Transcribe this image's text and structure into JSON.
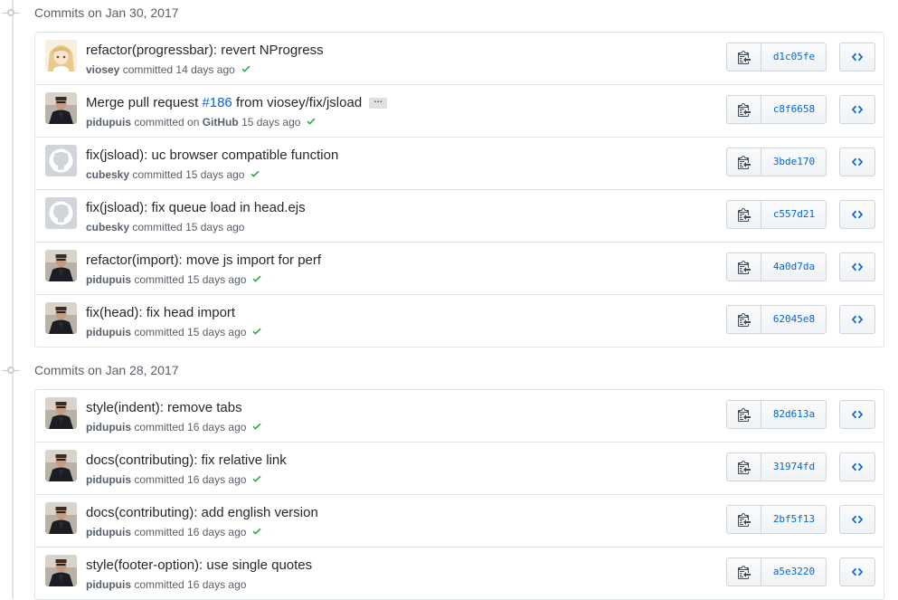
{
  "groups": [
    {
      "title": "Commits on Jan 30, 2017",
      "commits": [
        {
          "message": "refactor(progressbar): revert NProgress",
          "author": "viosey",
          "action": "committed",
          "time": "14 days ago",
          "sha": "d1c05fe",
          "avatar": "anime",
          "verified": true
        },
        {
          "message_pre": "Merge pull request ",
          "issue": "#186",
          "message_post": " from viosey/fix/jsload",
          "ellipsis": "…",
          "author": "pidupuis",
          "action": "committed on",
          "platform": "GitHub",
          "time": "15 days ago",
          "sha": "c8f6658",
          "avatar": "person",
          "verified": true
        },
        {
          "message": "fix(jsload): uc browser compatible function",
          "author": "cubesky",
          "action": "committed",
          "time": "15 days ago",
          "sha": "3bde170",
          "avatar": "github-default",
          "verified": true
        },
        {
          "message": "fix(jsload): fix queue load in head.ejs",
          "author": "cubesky",
          "action": "committed",
          "time": "15 days ago",
          "sha": "c557d21",
          "avatar": "github-default",
          "verified": false
        },
        {
          "message": "refactor(import): move js import for perf",
          "author": "pidupuis",
          "action": "committed",
          "time": "15 days ago",
          "sha": "4a0d7da",
          "avatar": "person",
          "verified": true
        },
        {
          "message": "fix(head): fix head import",
          "author": "pidupuis",
          "action": "committed",
          "time": "15 days ago",
          "sha": "62045e8",
          "avatar": "person",
          "verified": true
        }
      ]
    },
    {
      "title": "Commits on Jan 28, 2017",
      "commits": [
        {
          "message": "style(indent): remove tabs",
          "author": "pidupuis",
          "action": "committed",
          "time": "16 days ago",
          "sha": "82d613a",
          "avatar": "person",
          "verified": true
        },
        {
          "message": "docs(contributing): fix relative link",
          "author": "pidupuis",
          "action": "committed",
          "time": "16 days ago",
          "sha": "31974fd",
          "avatar": "person",
          "verified": true
        },
        {
          "message": "docs(contributing): add english version",
          "author": "pidupuis",
          "action": "committed",
          "time": "16 days ago",
          "sha": "2bf5f13",
          "avatar": "person",
          "verified": true
        },
        {
          "message": "style(footer-option): use single quotes",
          "author": "pidupuis",
          "action": "committed",
          "time": "16 days ago",
          "sha": "a5e3220",
          "avatar": "person",
          "verified": false
        }
      ]
    }
  ],
  "icons": {
    "copy": "clipboard-icon",
    "browse": "code-icon",
    "status": "check-icon"
  },
  "colors": {
    "link": "#0366d6",
    "success": "#28a745",
    "muted": "#586069",
    "border": "#e1e4e8"
  }
}
